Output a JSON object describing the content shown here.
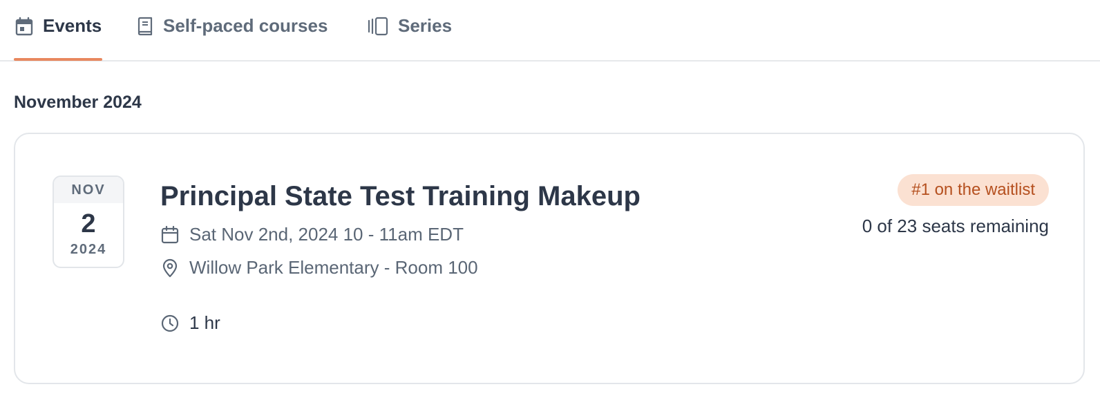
{
  "tabs": [
    {
      "label": "Events",
      "icon": "calendar-icon",
      "active": true
    },
    {
      "label": "Self-paced courses",
      "icon": "book-icon",
      "active": false
    },
    {
      "label": "Series",
      "icon": "series-icon",
      "active": false
    }
  ],
  "month_heading": "November 2024",
  "event": {
    "date_badge": {
      "month": "NOV",
      "day": "2",
      "year": "2024"
    },
    "title": "Principal State Test Training Makeup",
    "datetime": "Sat Nov 2nd, 2024 10 - 11am EDT",
    "location": "Willow Park Elementary - Room 100",
    "duration": "1 hr",
    "waitlist_label": "#1 on the waitlist",
    "seats_text": "0 of 23 seats remaining"
  },
  "colors": {
    "accent": "#e8885f",
    "waitlist_bg": "#fbe1d2",
    "waitlist_text": "#b5501f"
  }
}
